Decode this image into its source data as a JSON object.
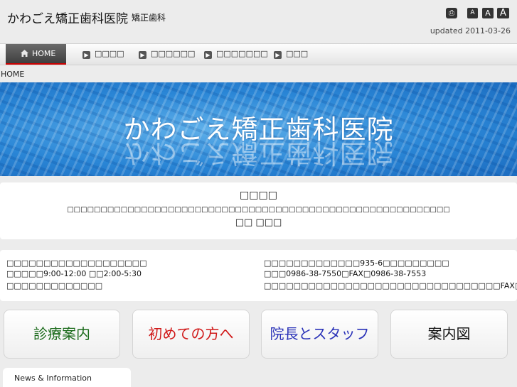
{
  "header": {
    "title": "かわごえ矯正歯科医院",
    "subtitle": "矯正歯科",
    "updated": "updated 2011-03-26",
    "print_icon": "printer-icon",
    "font_sizes": [
      "A",
      "A",
      "A"
    ]
  },
  "nav": {
    "items": [
      {
        "label": "HOME",
        "icon": "home-icon",
        "active": true
      },
      {
        "label": "□□□□",
        "icon": "arrow-right-icon"
      },
      {
        "label": "□□□□□□",
        "icon": "arrow-right-icon"
      },
      {
        "label": "□□□□□□□",
        "icon": "arrow-right-icon"
      },
      {
        "label": "□□□",
        "icon": "arrow-right-icon"
      }
    ]
  },
  "breadcrumb": "HOME",
  "hero": {
    "title": "かわごえ矯正歯科医院"
  },
  "intro": {
    "heading": "□□□□",
    "body": "□□□□□□□□□□□□□□□□□□□□□□□□□□□□□□□□□□□□□□□□□□□□□□□□□□□□□□□□□",
    "signature": "□□ □□□"
  },
  "info": {
    "left": [
      "□□□□□□□□□□□□□□□□□□□",
      "□□□□□9:00-12:00 □□2:00-5:30",
      "□□□□□□□□□□□□□"
    ],
    "right": [
      "□□□□□□□□□□□□□935-6□□□□□□□□□",
      "□□□0986-38-7550□FAX□0986-38-7553",
      "□□□□□□□□□□□□□□□□□□□□□□□□□□□□□□□□FAX□□"
    ]
  },
  "buttons": [
    {
      "label": "診療案内",
      "color": "#1a6a1a"
    },
    {
      "label": "初めての方へ",
      "color": "#d01818"
    },
    {
      "label": "院長とスタッフ",
      "color": "#2a32b8"
    },
    {
      "label": "案内図",
      "color": "#111111"
    }
  ],
  "news": {
    "label": "News & Information"
  }
}
